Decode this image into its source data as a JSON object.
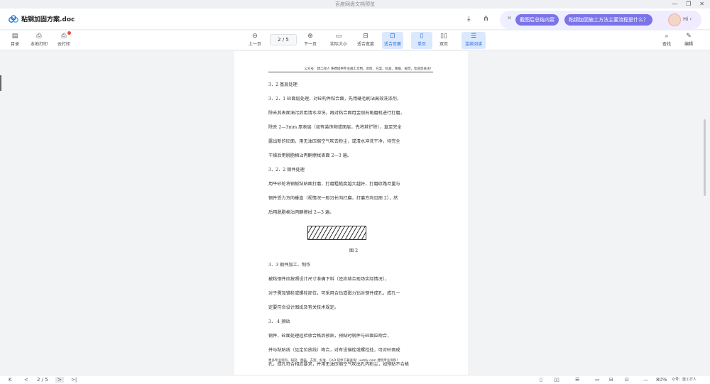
{
  "app": {
    "window_title": "百度网盘文档预览",
    "file_name": "粘钢加固方案.doc"
  },
  "ai": {
    "chip1": "截图后总结内容",
    "chip2": "粘钢加固施工方法主要流程是什么？",
    "hi": "Hi ›"
  },
  "toolbar": {
    "catalog": "目录",
    "local_print": "本地打印",
    "cloud_print": "云打印",
    "prev": "上一页",
    "page": "2 / 5",
    "next": "下一页",
    "actual_size": "实际大小",
    "fit_width": "适合宽度",
    "fit_page": "适合页面",
    "single_page": "单页",
    "double_page": "双页",
    "continuous": "连续阅读",
    "find": "查找",
    "edit": "编辑"
  },
  "document": {
    "header": "公众号：建工绿人  免费提供专业施工文档、资料、方案、标准、图纸、规范，欢迎您关注！",
    "lines": [
      "3．2  基层处理",
      "3．2．1 砼面层处理，对砼构件粘合面，先用硬毛刷沾高效洗涤剂，",
      "除去其表面油污后用清水冲洗，再对粘合面用金刚石角磨机进行打磨，",
      "除去 2—3mm 厚表层（如有装饰物或面层，先将其铲除），直至完全",
      "露出新的砼面，用无油压缩空气吹去粉尘，或清水冲洗干净，待完全",
      "干燥后用脱脂棉沾丙酮擦拭表面 2—3 遍。",
      "3．2．2 钢件处理",
      "用平砂轮将钢板粘贴面打磨，打磨粗糙度越大越好，打磨纹路尽量与",
      "钢件受力方向垂直（视情况一般沿长向打磨，打磨方向见图 2），然",
      "后用脱脂棉沾丙酮擦拭 2—3 遍。"
    ],
    "figure_caption": "图 2",
    "lines2": [
      "3．3 钢件加工、制作",
      "      被粘钢件应按照设计尺寸准确下料（还应结合现场实际情况），",
      "对于需加锚栓或螺栓部位，可采用合钻或磁力钻对钢件成孔，成孔一",
      "定要符合设计图纸及有关技术规定。",
      "3．    4 预贴",
      "      钢件、砼面处理经验收合格后预贴，预贴时钢件与砼面应吻合，",
      "并与粘贴线（见定位放线）吻合，对有设锚栓或螺栓处，可对砼面成",
      "孔，成孔符合相应要求，并用无油压缩空气吹出孔内粉尘，如预贴不合格"
    ],
    "footer": "更多专业资料、研究、图表、方案、标准、CAD 软件下载查询：wdzjk.com 建筑专业资料！"
  },
  "bottom": {
    "first": "K",
    "prev": "<",
    "page": "2 / 5",
    "next": ">",
    "last": ">|",
    "zoom": "80%",
    "zoom_minus": "—",
    "zoom_plus": "+",
    "watermark": "众号：建工行人"
  }
}
